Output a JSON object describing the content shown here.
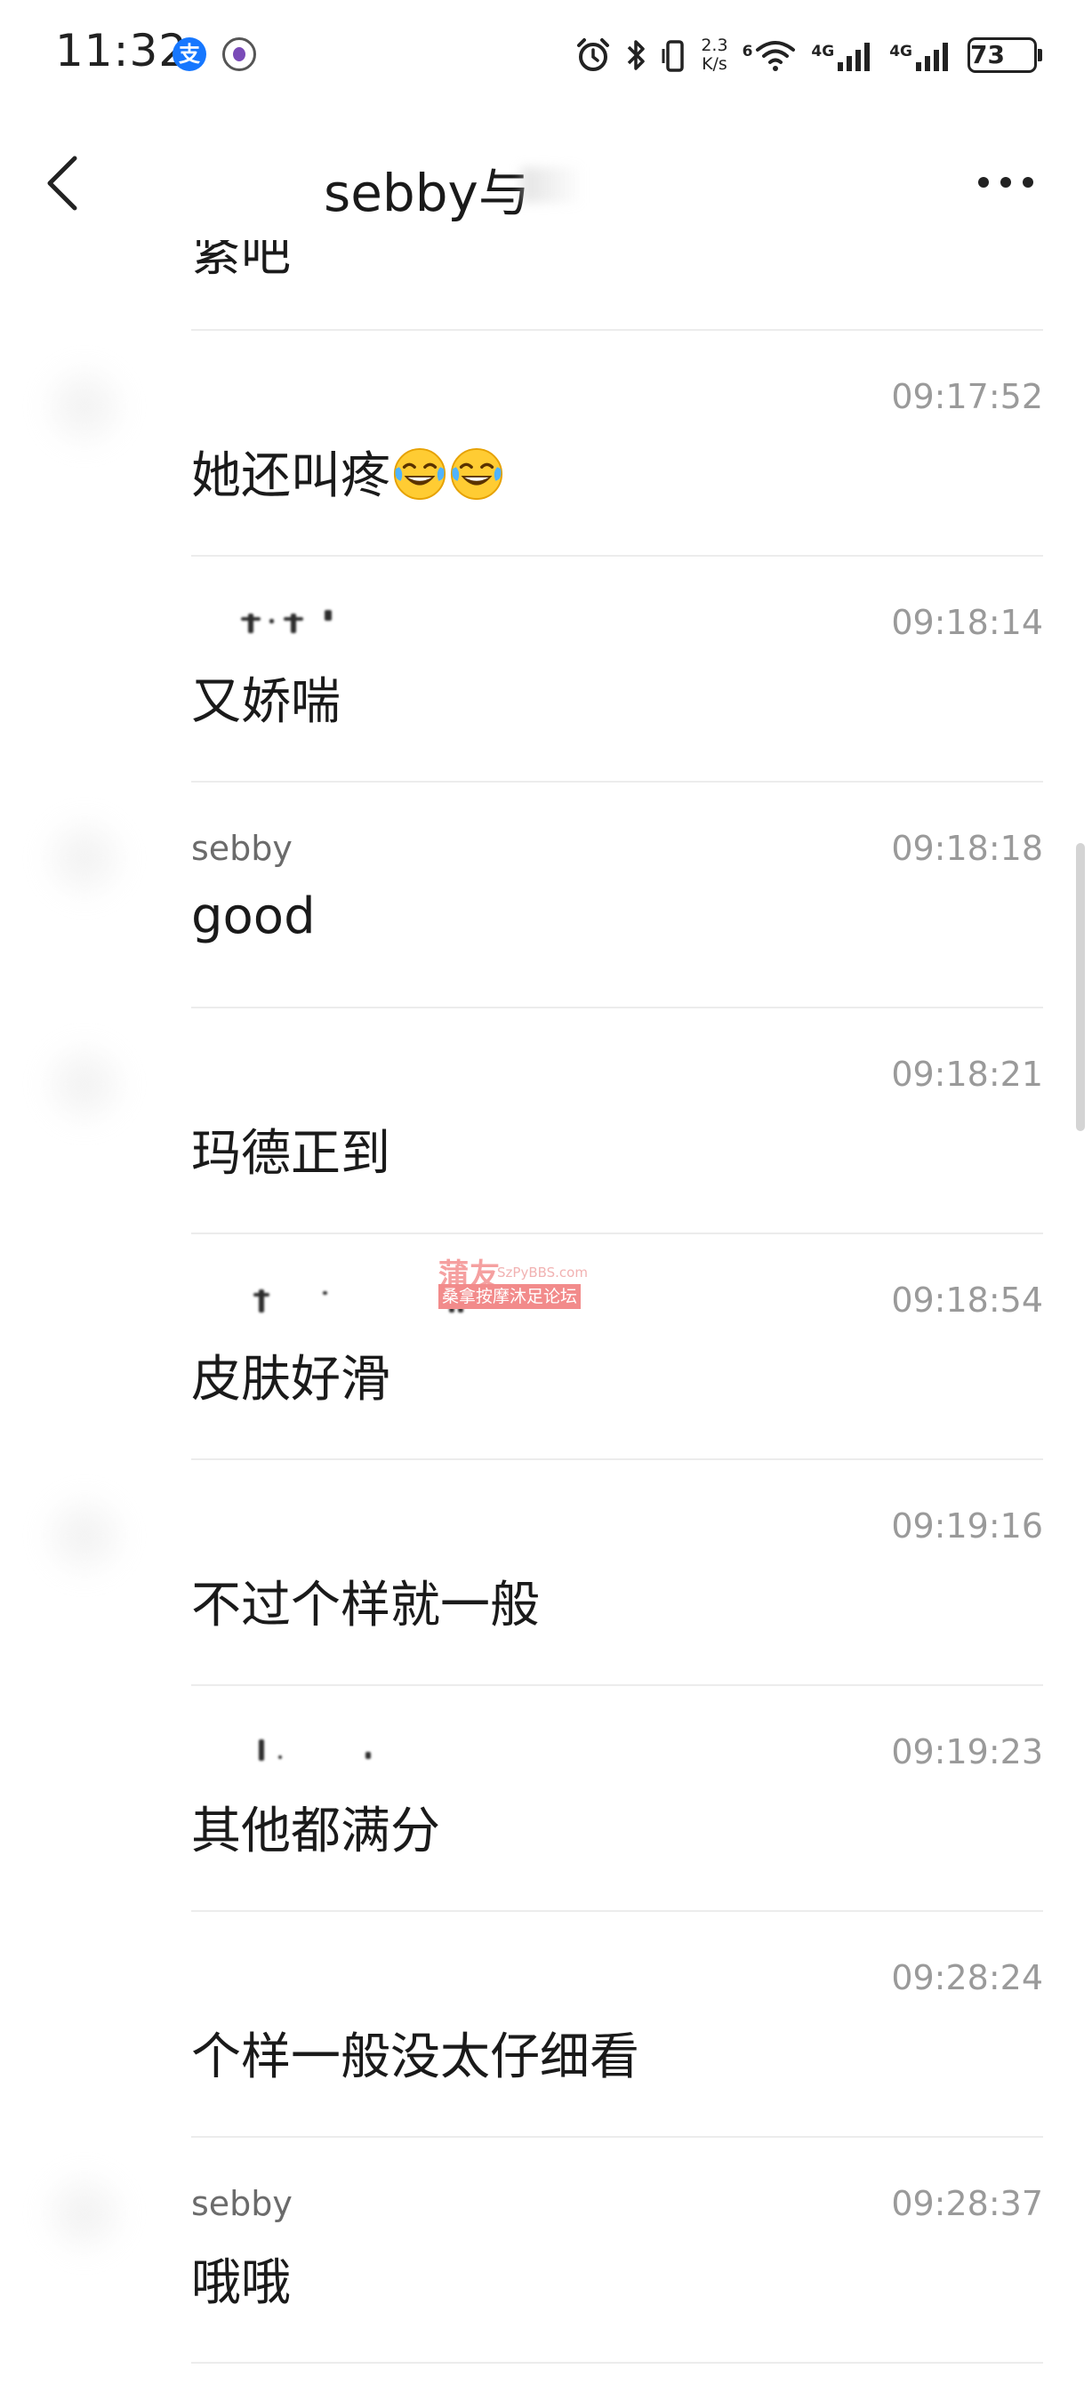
{
  "status_bar": {
    "time": "11:32",
    "alipay_glyph": "支",
    "net_speed_value": "2.3",
    "net_speed_unit": "K/s",
    "wifi_label": "6",
    "sim1_label": "4G",
    "sim2_label": "4G",
    "battery": "73",
    "icons": [
      "alipay-icon",
      "app-badge-icon",
      "alarm-icon",
      "bluetooth-icon",
      "vibrate-icon",
      "wifi-icon",
      "signal-icon",
      "signal-icon",
      "battery-icon"
    ]
  },
  "nav": {
    "title": "sebby与",
    "back_icon": "chevron-left-icon",
    "more_icon": "more-dots-icon"
  },
  "partial_top_text": "紧吧",
  "records": [
    {
      "sender": "",
      "time": "09:17:52",
      "text": "她还叫疼",
      "emoji_count": 2
    },
    {
      "sender": "",
      "time": "09:18:14",
      "text": "又娇喘"
    },
    {
      "sender": "sebby",
      "time": "09:18:18",
      "text": "good"
    },
    {
      "sender": "",
      "time": "09:18:21",
      "text": "玛德正到"
    },
    {
      "sender": "",
      "time": "09:18:54",
      "text": "皮肤好滑"
    },
    {
      "sender": "",
      "time": "09:19:16",
      "text": "不过个样就一般"
    },
    {
      "sender": "",
      "time": "09:19:23",
      "text": "其他都满分"
    },
    {
      "sender": "",
      "time": "09:28:24",
      "text": "个样一般没太仔细看"
    },
    {
      "sender": "sebby",
      "time": "09:28:37",
      "text": "哦哦"
    }
  ],
  "watermark": {
    "main": "蒲友",
    "site": "SzPyBBS.com",
    "sub": "桑拿按摩沐足论坛"
  },
  "colors": {
    "time_gray": "#9a9a9a",
    "sender_gray": "#6b6b6b",
    "divider": "#ececec",
    "alipay_blue": "#1677ff",
    "watermark_red": "#f28b8b"
  }
}
